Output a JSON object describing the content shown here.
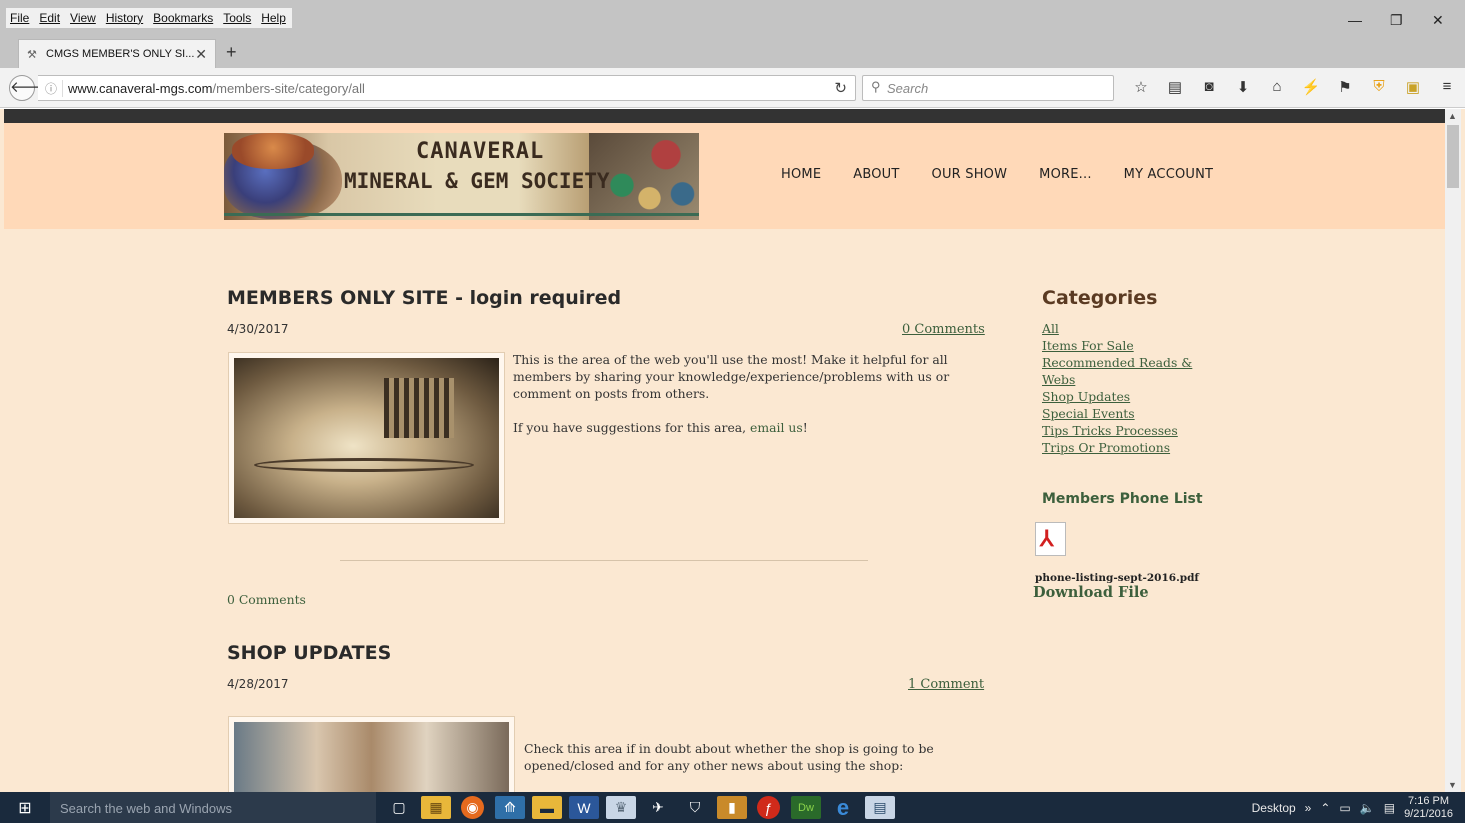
{
  "browser": {
    "menus": [
      "File",
      "Edit",
      "View",
      "History",
      "Bookmarks",
      "Tools",
      "Help"
    ],
    "tab": {
      "title": "CMGS MEMBER'S ONLY SI...",
      "close": "✕"
    },
    "new_tab": "+",
    "url_host": "www.canaveral-mgs.com",
    "url_path": "/members-site/category/all",
    "search_placeholder": "Search",
    "window_controls": [
      "—",
      "❐",
      "✕"
    ],
    "toolbar_icons": [
      "star-icon",
      "reading-list-icon",
      "pocket-icon",
      "download-icon",
      "home-icon",
      "extension-icon",
      "pin-icon",
      "shield-icon",
      "image-icon"
    ]
  },
  "site": {
    "logo": {
      "line1": "CANAVERAL",
      "line2": "MINERAL & GEM SOCIETY"
    },
    "nav": [
      "HOME",
      "ABOUT",
      "OUR SHOW",
      "MORE...",
      "MY ACCOUNT"
    ],
    "colors": {
      "header_bg": "#ffd9b8",
      "page_bg": "#fbe8d2",
      "link": "#3c5f3c",
      "accent_heading": "#5a3a22"
    }
  },
  "posts": [
    {
      "title": "MEMBERS ONLY SITE - login required",
      "date": "4/30/2017",
      "comments": "0 Comments",
      "body1": "This is the area of the web you'll use the most!  Make it helpful for all members by sharing your knowledge/experience/problems with us or comment on posts from others.",
      "body2_prefix": "If you have suggestions for this area, ",
      "body2_link": "email us",
      "body2_suffix": "!",
      "bottom_comments": "0 Comments"
    },
    {
      "title": "SHOP UPDATES",
      "date": "4/28/2017",
      "comments": "1 Comment",
      "body1": "Check this area if in doubt about whether the shop is going to be opened/closed and for any other news about using the shop:"
    }
  ],
  "sidebar": {
    "categories_title": "Categories",
    "categories": [
      "All",
      "Items For Sale",
      "Recommended Reads & Webs",
      "Shop Updates",
      "Special Events",
      "Tips Tricks Processes",
      "Trips Or Promotions"
    ],
    "phone_title": "Members Phone List",
    "file_name": "phone-listing-sept-2016.pdf",
    "download_label": "Download File"
  },
  "taskbar": {
    "search_placeholder": "Search the web and Windows",
    "desktop_label": "Desktop",
    "time": "7:16 PM",
    "date": "9/21/2016"
  }
}
